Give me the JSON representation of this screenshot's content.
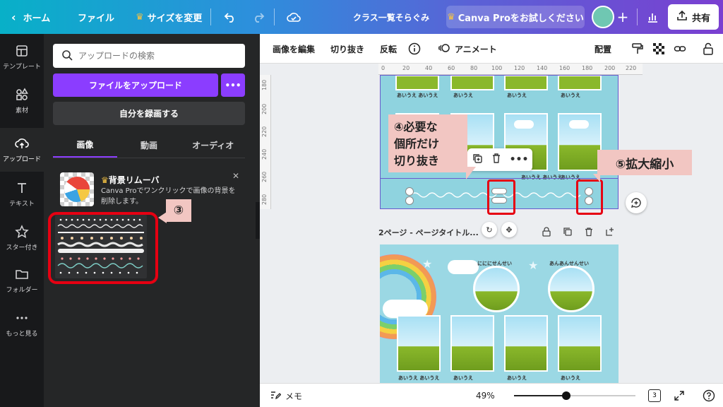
{
  "topbar": {
    "home": "ホーム",
    "file": "ファイル",
    "resize": "サイズを変更",
    "doc_title": "クラス一覧そらぐみ",
    "pro_cta": "Canva Proをお試しください",
    "share": "共有"
  },
  "rail": {
    "items": [
      {
        "label": "テンプレート",
        "icon": "template-icon"
      },
      {
        "label": "素材",
        "icon": "elements-icon"
      },
      {
        "label": "アップロード",
        "icon": "upload-cloud-icon"
      },
      {
        "label": "テキスト",
        "icon": "text-icon"
      },
      {
        "label": "スター付き",
        "icon": "star-icon"
      },
      {
        "label": "フォルダー",
        "icon": "folder-icon"
      },
      {
        "label": "もっと見る",
        "icon": "more-icon"
      }
    ]
  },
  "panel": {
    "search_placeholder": "アップロードの検索",
    "upload_button": "ファイルをアップロード",
    "more_button": "•••",
    "record_button": "自分を録画する",
    "tabs": [
      "画像",
      "動画",
      "オーディオ"
    ],
    "promo_title": "背景リムーバ",
    "promo_desc": "Canva Proでワンクリックで画像の背景を削除します。",
    "callout_3": "③"
  },
  "context_toolbar": {
    "edit_image": "画像を編集",
    "crop": "切り抜き",
    "flip": "反転",
    "animate": "アニメート",
    "position": "配置"
  },
  "ruler": {
    "h_ticks": [
      "0",
      "20",
      "40",
      "60",
      "80",
      "100",
      "120",
      "140",
      "160",
      "180",
      "200",
      "220"
    ],
    "v_ticks": [
      "180",
      "200",
      "220",
      "240",
      "260",
      "280"
    ]
  },
  "canvas": {
    "card_label": "あいうえ あいうえ",
    "card_label_single": "あいうえ",
    "callout_4": "④必要な\n個所だけ\n切り抜き",
    "callout_5": "⑤拡大縮小",
    "page2_title": "2ページ - ページタイトル...",
    "page2_teacher_1": "にににせんせい",
    "page2_teacher_2": "あんあんせんせい",
    "page2_card_label": "あいうえ あいうえ"
  },
  "bottombar": {
    "notes": "メモ",
    "zoom": "49%",
    "zoom_value": 0.49,
    "pages": "3"
  }
}
